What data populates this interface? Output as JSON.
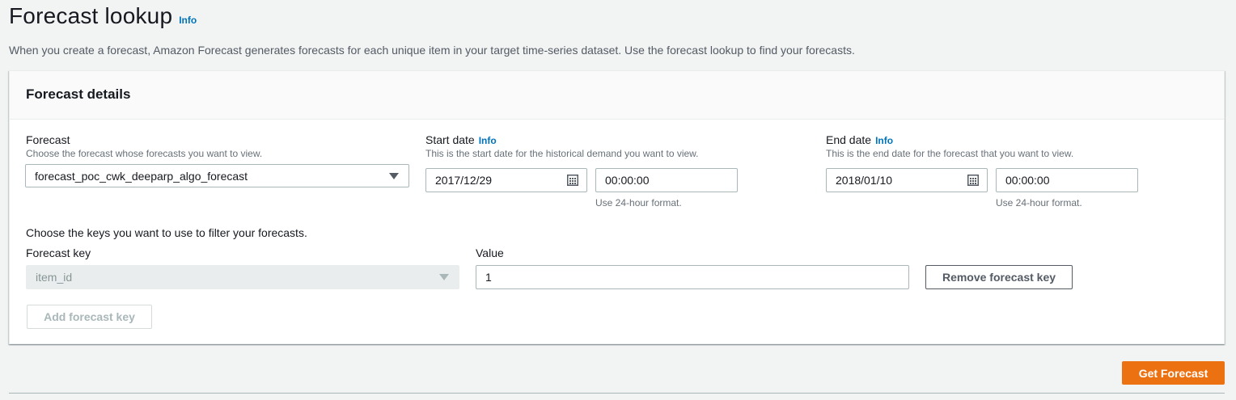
{
  "page": {
    "title": "Forecast lookup",
    "info_label": "Info",
    "description": "When you create a forecast, Amazon Forecast generates forecasts for each unique item in your target time-series dataset. Use the forecast lookup to find your forecasts."
  },
  "panel": {
    "title": "Forecast details",
    "forecast": {
      "label": "Forecast",
      "description": "Choose the forecast whose forecasts you want to view.",
      "selected": "forecast_poc_cwk_deeparp_algo_forecast"
    },
    "start_date": {
      "label": "Start date",
      "info_label": "Info",
      "description": "This is the start date for the historical demand you want to view.",
      "date_value": "2017/12/29",
      "time_value": "00:00:00",
      "time_hint": "Use 24-hour format."
    },
    "end_date": {
      "label": "End date",
      "info_label": "Info",
      "description": "This is the end date for the forecast that you want to view.",
      "date_value": "2018/01/10",
      "time_value": "00:00:00",
      "time_hint": "Use 24-hour format."
    },
    "keys": {
      "intro": "Choose the keys you want to use to filter your forecasts.",
      "key_label": "Forecast key",
      "key_selected": "item_id",
      "value_label": "Value",
      "value": "1",
      "remove_button": "Remove forecast key",
      "add_button": "Add forecast key"
    }
  },
  "actions": {
    "get_forecast_button": "Get Forecast"
  },
  "colors": {
    "accent_link": "#0073bb",
    "primary_button": "#ec7211",
    "page_background": "#f2f3f3"
  },
  "icons": {
    "dropdown": "caret-down-icon",
    "date_picker": "calendar-icon"
  }
}
